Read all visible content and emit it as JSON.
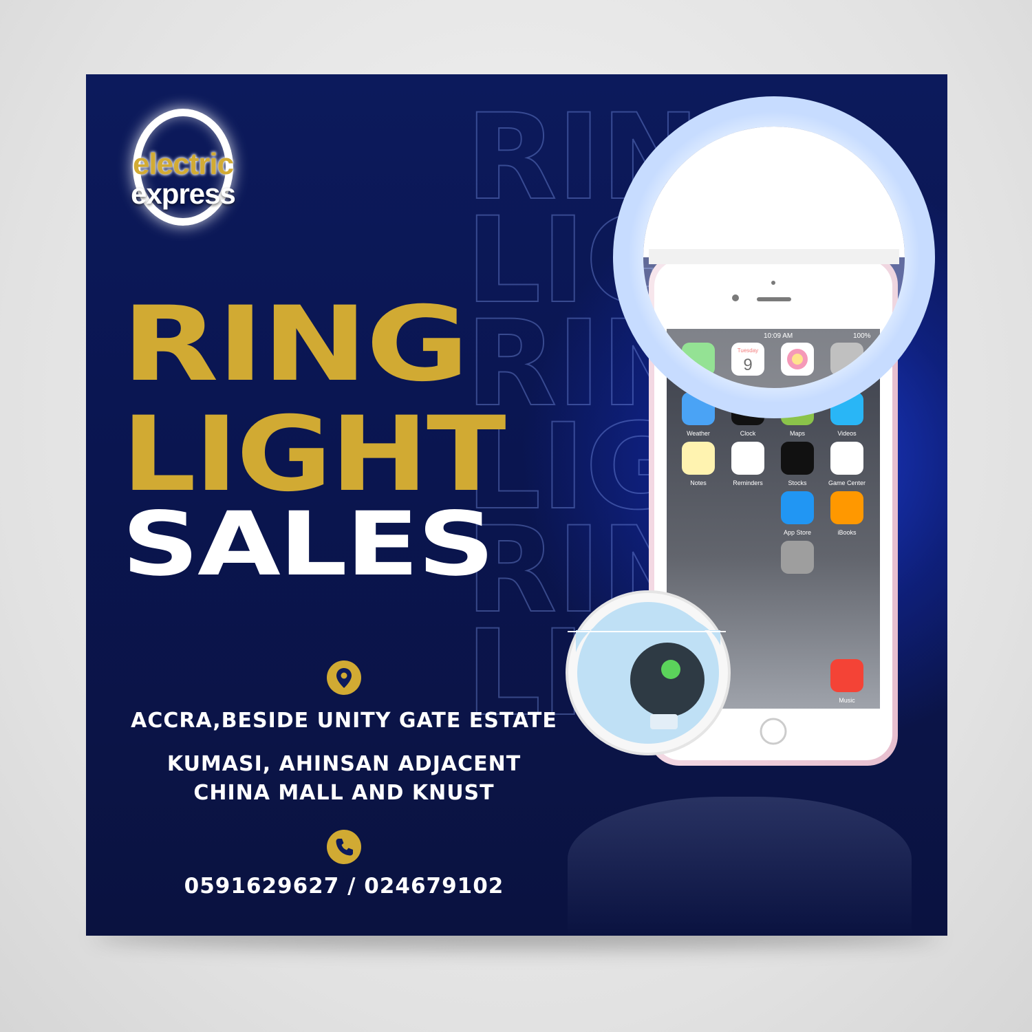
{
  "brand": {
    "line1": "electric",
    "line2": "express"
  },
  "background_text": [
    "RING",
    "LIGHT",
    "RING",
    "LIGHT",
    "RING",
    "LIGHT"
  ],
  "headline": {
    "line1": "RING",
    "line2": "LIGHT",
    "line3": "SALES"
  },
  "locations": {
    "icon": "location-pin-icon",
    "line1": "ACCRA,BESIDE UNITY GATE ESTATE",
    "line2a": "KUMASI, AHINSAN ADJACENT",
    "line2b": "CHINA MALL AND KNUST"
  },
  "contact": {
    "icon": "phone-icon",
    "numbers": "0591629627 / 024679102"
  },
  "phone_screen": {
    "time": "10:09 AM",
    "battery": "100%",
    "calendar_day": "Tuesday",
    "calendar_date": "9",
    "apps": [
      "Weather",
      "Clock",
      "Maps",
      "Videos",
      "Notes",
      "Reminders",
      "Stocks",
      "Game Center",
      "App Store",
      "iBooks",
      "Music"
    ]
  },
  "colors": {
    "gold": "#d1aa33",
    "navy": "#0c1a5c",
    "accent_blue": "#1c3cd2",
    "white": "#ffffff"
  }
}
